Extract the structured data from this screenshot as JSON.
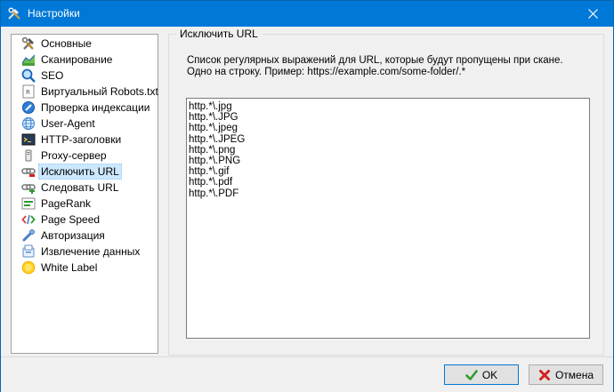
{
  "window": {
    "title": "Настройки",
    "close_label": "×"
  },
  "sidebar": {
    "items": [
      {
        "label": "Основные",
        "icon": "tools-icon"
      },
      {
        "label": "Сканирование",
        "icon": "chart-icon"
      },
      {
        "label": "SEO",
        "icon": "magnifier-icon"
      },
      {
        "label": "Виртуальный Robots.txt",
        "icon": "robots-file-icon"
      },
      {
        "label": "Проверка индексации",
        "icon": "index-check-icon"
      },
      {
        "label": "User-Agent",
        "icon": "globe-icon"
      },
      {
        "label": "HTTP-заголовки",
        "icon": "terminal-icon"
      },
      {
        "label": "Proxy-сервер",
        "icon": "proxy-icon"
      },
      {
        "label": "Исключить URL",
        "icon": "exclude-link-icon",
        "selected": true
      },
      {
        "label": "Следовать URL",
        "icon": "follow-link-icon"
      },
      {
        "label": "PageRank",
        "icon": "pagerank-icon"
      },
      {
        "label": "Page Speed",
        "icon": "code-icon"
      },
      {
        "label": "Авторизация",
        "icon": "key-icon"
      },
      {
        "label": "Извлечение данных",
        "icon": "extract-icon"
      },
      {
        "label": "White Label",
        "icon": "sun-icon"
      }
    ]
  },
  "panel": {
    "title": "Исключить URL",
    "description_line1": "Список регулярных выражений для URL, которые будут пропущены при скане.",
    "description_line2": "Одно на строку. Пример: https://example.com/some-folder/.*",
    "patterns": [
      "http.*\\.jpg",
      "http.*\\.JPG",
      "http.*\\.jpeg",
      "http.*\\.JPEG",
      "http.*\\.png",
      "http.*\\.PNG",
      "http.*\\.gif",
      "http.*\\.pdf",
      "http.*\\.PDF"
    ]
  },
  "footer": {
    "ok_label": "OK",
    "cancel_label": "Отмена"
  },
  "colors": {
    "titlebar": "#0078d7",
    "selection": "#cce8ff"
  }
}
